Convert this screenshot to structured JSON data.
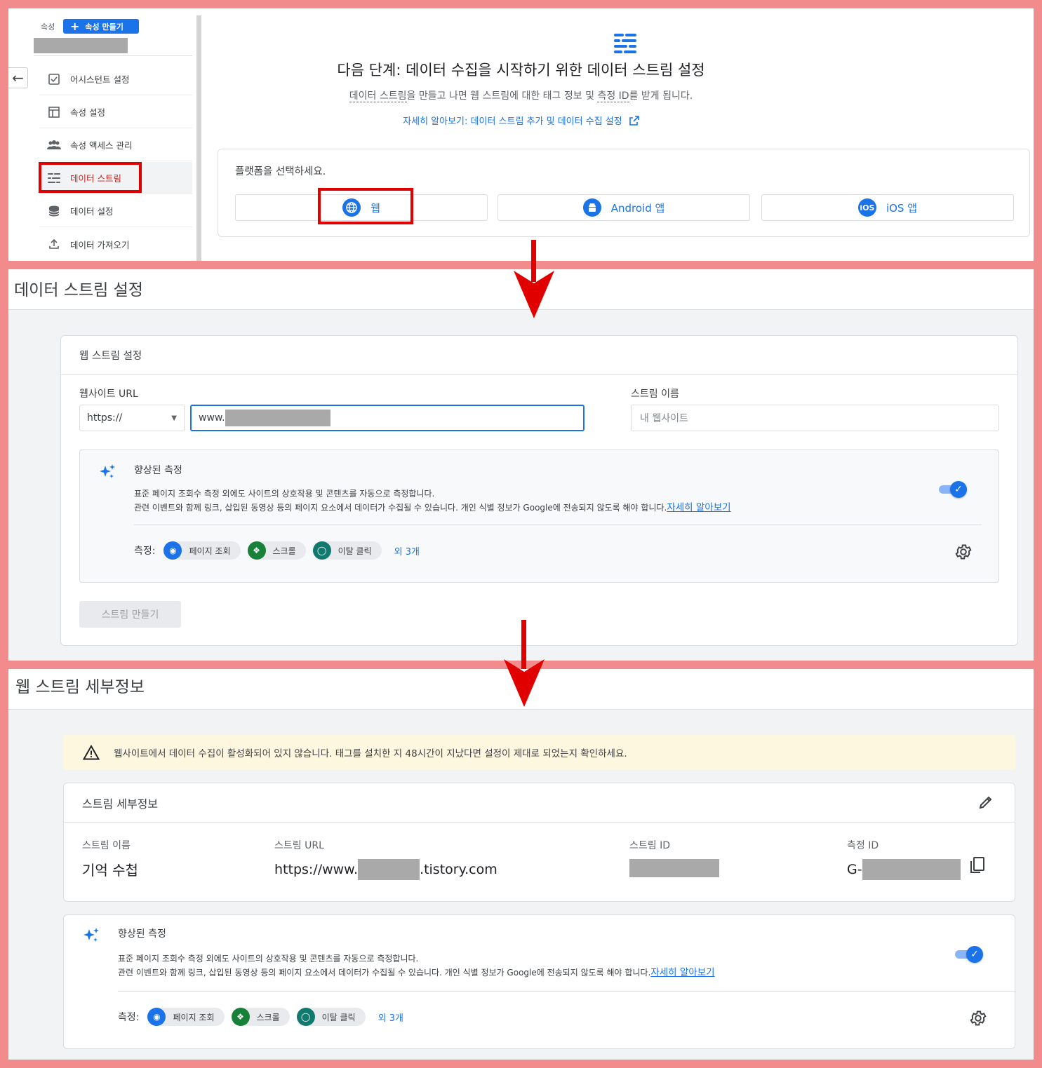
{
  "panel1": {
    "sidebar": {
      "property_label": "속성",
      "create_property_button": "속성 만들기",
      "items": [
        {
          "label": "어시스턴트 설정",
          "icon": "checklist-icon"
        },
        {
          "label": "속성 설정",
          "icon": "layout-icon"
        },
        {
          "label": "속성 액세스 관리",
          "icon": "people-icon"
        },
        {
          "label": "데이터 스트림",
          "icon": "streams-icon",
          "active": true
        },
        {
          "label": "데이터 설정",
          "icon": "database-icon"
        },
        {
          "label": "데이터 가져오기",
          "icon": "upload-icon"
        }
      ]
    },
    "main": {
      "headline": "다음 단계: 데이터 수집을 시작하기 위한 데이터 스트림 설정",
      "sub_part1": "데이터 스트림",
      "sub_part2": "을 만들고 나면 웹 스트림에 대한 태그 정보 및 ",
      "sub_part3": "측정 ID",
      "sub_part4": "를 받게 됩니다.",
      "learn_more": "자세히 알아보기: 데이터 스트림 추가 및 데이터 수집 설정",
      "platform_prompt": "플랫폼을 선택하세요.",
      "platforms": [
        {
          "label": "웹",
          "icon": "globe-icon"
        },
        {
          "label": "Android 앱",
          "icon": "android-icon"
        },
        {
          "label": "iOS 앱",
          "icon": "ios-icon",
          "icon_text": "iOS"
        }
      ]
    }
  },
  "panel2": {
    "title": "데이터 스트림 설정",
    "card_title": "웹 스트림 설정",
    "website_url_label": "웹사이트 URL",
    "protocol_value": "https://",
    "url_value": "www.",
    "stream_name_label": "스트림 이름",
    "stream_name_placeholder": "내 웹사이트",
    "enhanced": {
      "title": "향상된 측정",
      "desc1": "표준 페이지 조회수 측정 외에도 사이트의 상호작용 및 콘텐츠를 자동으로 측정합니다.",
      "desc2": "관련 이벤트와 함께 링크, 삽입된 동영상 등의 페이지 요소에서 데이터가 수집될 수 있습니다. 개인 식별 정보가 Google에 전송되지 않도록 해야 합니다.",
      "learn_more": "자세히 알아보기",
      "measure_label": "측정:",
      "chips": [
        "페이지 조회",
        "스크롤",
        "이탈 클릭"
      ],
      "more": "외 3개"
    },
    "create_button": "스트림 만들기"
  },
  "panel3": {
    "title": "웹 스트림 세부정보",
    "warning": "웹사이트에서 데이터 수집이 활성화되어 있지 않습니다. 태그를 설치한 지 48시간이 지났다면 설정이 제대로 되었는지 확인하세요.",
    "card_title": "스트림 세부정보",
    "stream_name_label": "스트림 이름",
    "stream_name_value": "기억 수첩",
    "stream_url_label": "스트림 URL",
    "stream_url_prefix": "https://www.",
    "stream_url_suffix": ".tistory.com",
    "stream_id_label": "스트림 ID",
    "measurement_id_label": "측정 ID",
    "measurement_id_prefix": "G-",
    "enhanced": {
      "title": "향상된 측정",
      "desc1": "표준 페이지 조회수 측정 외에도 사이트의 상호작용 및 콘텐츠를 자동으로 측정합니다.",
      "desc2": "관련 이벤트와 함께 링크, 삽입된 동영상 등의 페이지 요소에서 데이터가 수집될 수 있습니다. 개인 식별 정보가 Google에 전송되지 않도록 해야 합니다.",
      "learn_more": "자세히 알아보기",
      "measure_label": "측정:",
      "chips": [
        "페이지 조회",
        "스크롤",
        "이탈 클릭"
      ],
      "more": "외 3개"
    }
  },
  "colors": {
    "frame": "#f28b8b",
    "accent": "#1a73e8",
    "highlight": "#e00000",
    "chip_blue": "#1a73e8",
    "chip_green": "#188038",
    "chip_teal": "#12796e"
  }
}
